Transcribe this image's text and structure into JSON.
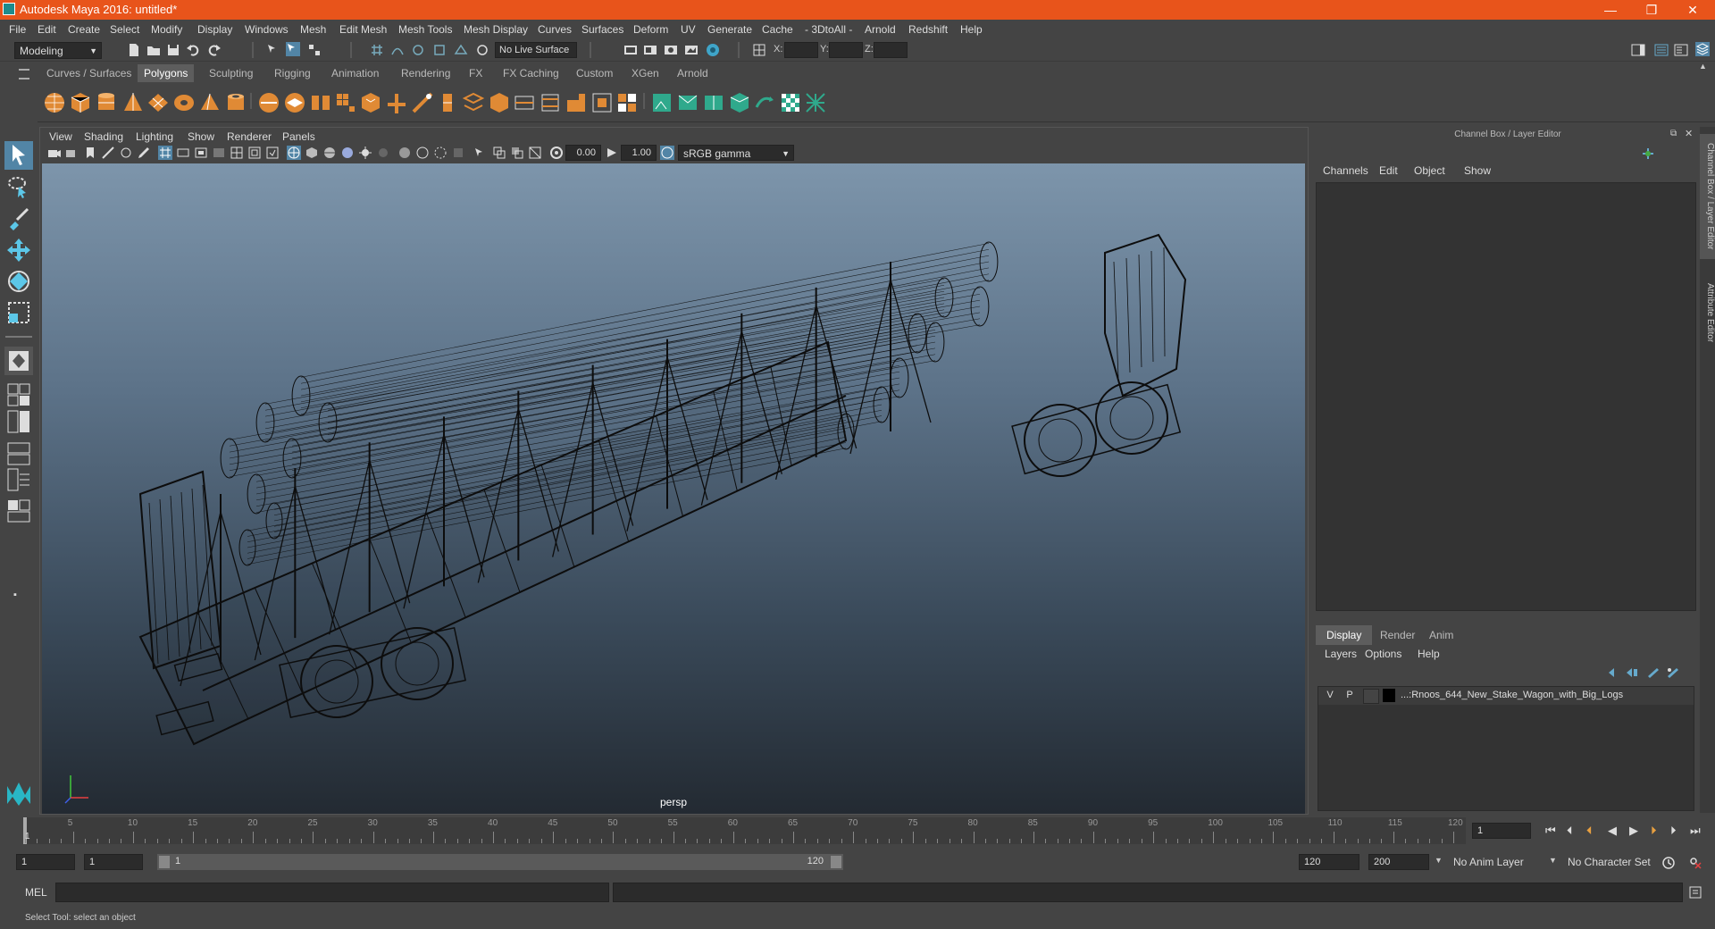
{
  "window": {
    "title": "Autodesk Maya 2016: untitled*",
    "controls": [
      "—",
      "❐",
      "✕"
    ]
  },
  "menubar": {
    "items": [
      "File",
      "Edit",
      "Create",
      "Select",
      "Modify",
      "Display",
      "Windows",
      "Mesh",
      "Edit Mesh",
      "Mesh Tools",
      "Mesh Display",
      "Curves",
      "Surfaces",
      "Deform",
      "UV",
      "Generate",
      "Cache",
      "- 3DtoAll -",
      "Arnold",
      "Redshift",
      "Help"
    ]
  },
  "statusline": {
    "mode": "Modeling",
    "live_surface": "No Live Surface",
    "x_label": "X:",
    "y_label": "Y:",
    "z_label": "Z:"
  },
  "shelf": {
    "tabs": [
      "Curves / Surfaces",
      "Polygons",
      "Sculpting",
      "Rigging",
      "Animation",
      "Rendering",
      "FX",
      "FX Caching",
      "Custom",
      "XGen",
      "Arnold"
    ],
    "active_tab": "Polygons"
  },
  "viewport": {
    "menu": [
      "View",
      "Shading",
      "Lighting",
      "Show",
      "Renderer",
      "Panels"
    ],
    "near_clip": "0.00",
    "exposure": "1.00",
    "colorspace": "sRGB gamma",
    "camera_label": "persp",
    "background_top": "#7d95ab",
    "background_bottom": "#232a32",
    "wire_color": "#0d0d0d"
  },
  "channelbox": {
    "header": "Channel Box / Layer Editor",
    "menu": [
      "Channels",
      "Edit",
      "Object",
      "Show"
    ]
  },
  "layer_editor": {
    "tabs": [
      "Display",
      "Render",
      "Anim"
    ],
    "active_tab": "Display",
    "menu": [
      "Layers",
      "Options",
      "Help"
    ],
    "layers": [
      {
        "visible": "V",
        "playback": "P",
        "name": "...:Rnoos_644_New_Stake_Wagon_with_Big_Logs"
      }
    ]
  },
  "side_tabs": [
    "Channel Box / Layer Editor",
    "Attribute Editor"
  ],
  "timeslider": {
    "ticks": [
      "5",
      "10",
      "15",
      "20",
      "25",
      "30",
      "35",
      "40",
      "45",
      "50",
      "55",
      "60",
      "65",
      "70",
      "75",
      "80",
      "85",
      "90",
      "95",
      "100",
      "105",
      "110",
      "115",
      "120"
    ],
    "start_label": "1",
    "current_frame": "1"
  },
  "rangeslider": {
    "start": "1",
    "playback_start": "1",
    "range_start_label": "1",
    "range_end_label": "120",
    "playback_end": "120",
    "end": "200",
    "anim_layer": "No Anim Layer",
    "character_set": "No Character Set"
  },
  "cmdline": {
    "label": "MEL"
  },
  "helpline": {
    "text": "Select Tool: select an object"
  }
}
